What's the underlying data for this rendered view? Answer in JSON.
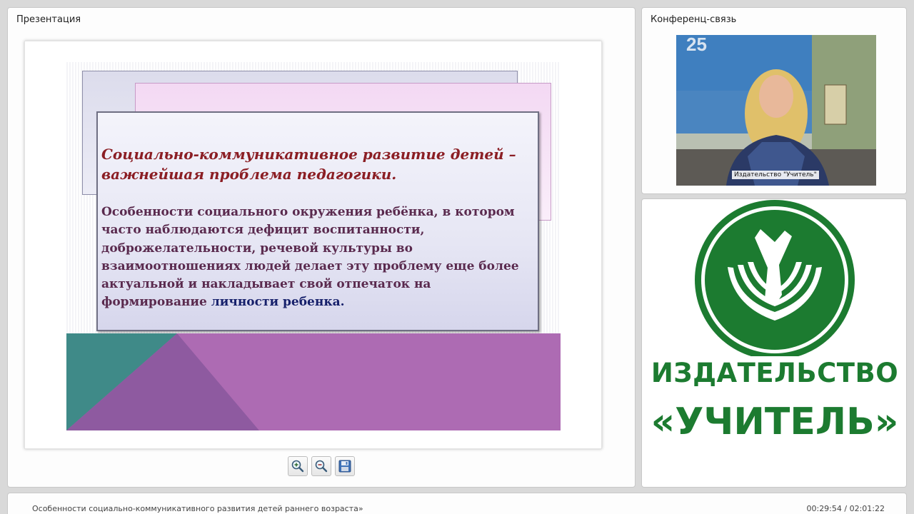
{
  "presentation": {
    "title": "Презентация",
    "slide": {
      "heading": "Социально-коммуникативное развитие детей – важнейшая проблема педагогики.",
      "body_text": "Особенности социального окружения ребёнка, в котором часто наблюдаются дефицит воспитанности, доброжелательности, речевой культуры во взаимоотношениях людей делает эту проблему еще более актуальной  и накладывает свой отпечаток на формирование ",
      "body_highlight": "личности ребенка."
    },
    "toolbar": {
      "zoom_in_icon": "zoom-in-icon",
      "zoom_out_icon": "zoom-out-icon",
      "save_icon": "save-icon"
    }
  },
  "conference": {
    "title": "Конференц-связь",
    "video_caption": "Издательство \"Учитель\""
  },
  "logo": {
    "line1": "ИЗДАТЕЛЬСТВО",
    "line2": "«УЧИТЕЛЬ»",
    "color": "#1c7b30"
  },
  "status": {
    "lecture_title": "Особенности социально-коммуникативного развития детей раннего возраста»",
    "time": "00:29:54 / 02:01:22"
  },
  "colors": {
    "heading": "#8b1e24",
    "body": "#5a2a4e",
    "highlight": "#16206b",
    "slide_bottom": "#a86ab0",
    "slide_teal": "#3f8a88"
  }
}
